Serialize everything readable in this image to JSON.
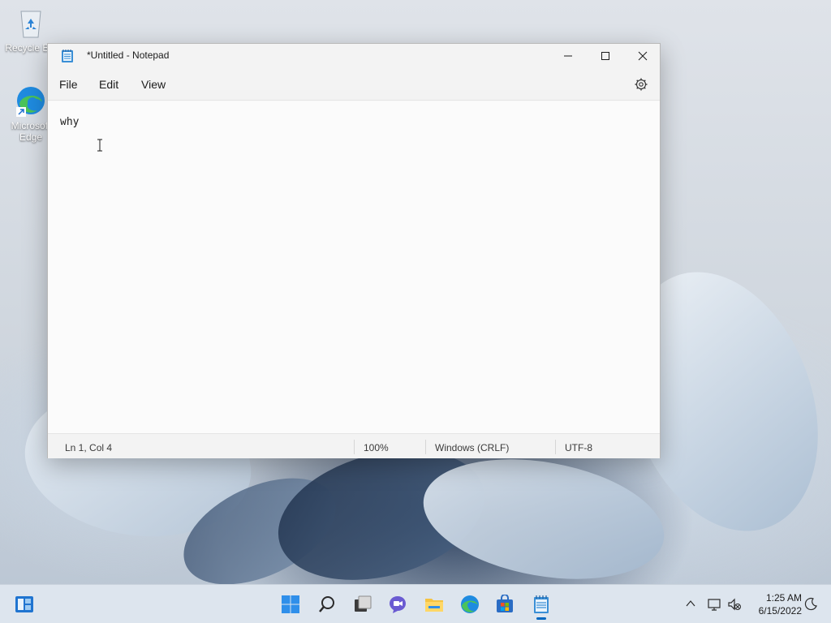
{
  "desktop": {
    "icons": [
      {
        "label": "Recycle Bin",
        "icon": "recycle-bin-icon"
      },
      {
        "label": "Microsoft Edge",
        "icon": "edge-icon"
      }
    ]
  },
  "window": {
    "title": "*Untitled - Notepad",
    "menu": {
      "file": "File",
      "edit": "Edit",
      "view": "View"
    },
    "editor_text": "why",
    "status": {
      "position": "Ln 1, Col 4",
      "zoom": "100%",
      "line_ending": "Windows (CRLF)",
      "encoding": "UTF-8"
    }
  },
  "taskbar": {
    "apps": [
      "widgets-icon",
      "start-icon",
      "search-icon",
      "task-view-icon",
      "chat-icon",
      "file-explorer-icon",
      "edge-icon",
      "store-icon",
      "notepad-icon"
    ],
    "clock": {
      "time": "1:25 AM",
      "date": "6/15/2022"
    }
  },
  "colors": {
    "accent": "#0067c0",
    "edge_blue": "#1f8be0",
    "edge_green": "#4bc35a"
  }
}
